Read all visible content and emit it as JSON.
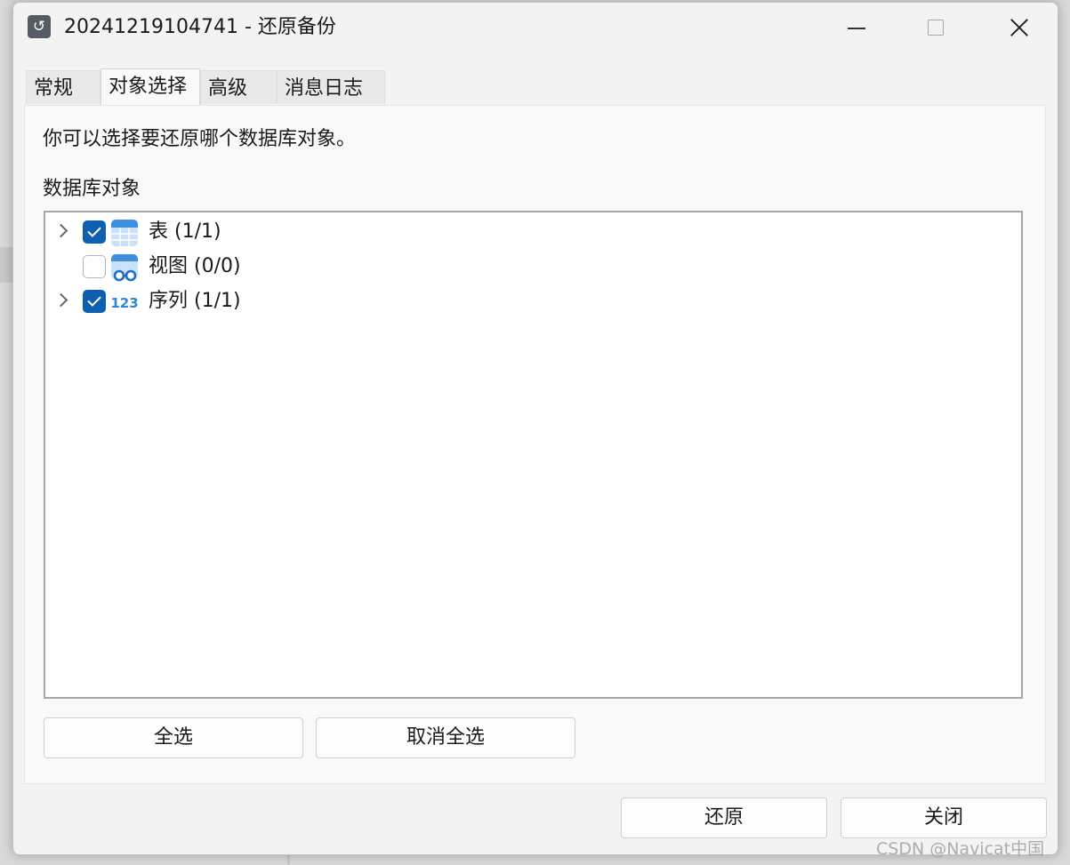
{
  "window": {
    "title": "20241219104741 - 还原备份",
    "app_icon": "restore-icon"
  },
  "tabs": [
    {
      "label": "常规",
      "active": false
    },
    {
      "label": "对象选择",
      "active": true
    },
    {
      "label": "高级",
      "active": false
    },
    {
      "label": "消息日志",
      "active": false
    }
  ],
  "panel": {
    "description": "你可以选择要还原哪个数据库对象。",
    "group_label": "数据库对象"
  },
  "tree": [
    {
      "label": "表 (1/1)",
      "checked": true,
      "expandable": true,
      "icon": "table-icon"
    },
    {
      "label": "视图 (0/0)",
      "checked": false,
      "expandable": false,
      "icon": "view-icon"
    },
    {
      "label": "序列 (1/1)",
      "checked": true,
      "expandable": true,
      "icon": "sequence-icon"
    }
  ],
  "buttons": {
    "select_all": "全选",
    "deselect_all": "取消全选",
    "restore": "还原",
    "close": "关闭"
  },
  "colors": {
    "checkbox_checked": "#0f5fb0",
    "icon_blue": "#3f8fe0"
  },
  "watermark": "CSDN @Navicat中国"
}
